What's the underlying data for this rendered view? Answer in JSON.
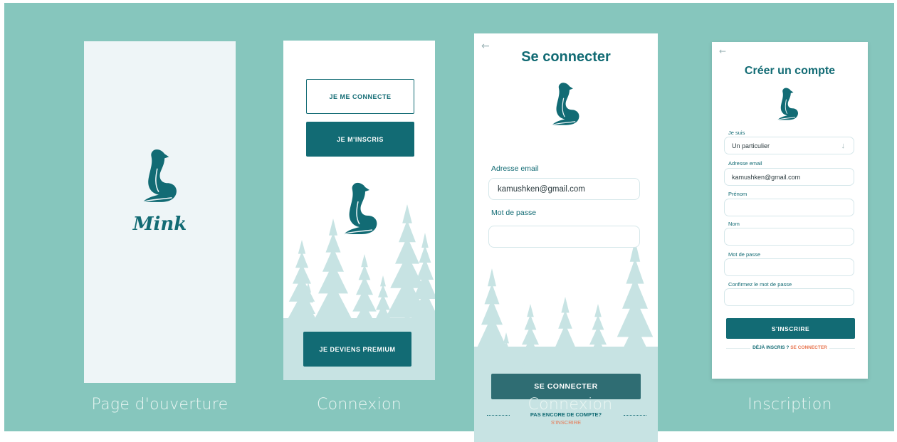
{
  "colors": {
    "canvas": "#86c6bd",
    "brand": "#126b74",
    "accent": "#e8754f",
    "trees": "#c7e3e3"
  },
  "screens": {
    "opening": {
      "brand_name": "Mink",
      "caption": "Page d'ouverture"
    },
    "connexion": {
      "login_button": "JE ME CONNECTE",
      "signup_button": "JE M'INSCRIS",
      "premium_button": "JE DEVIENS PREMIUM",
      "caption": "Connexion"
    },
    "login": {
      "title": "Se connecter",
      "email_label": "Adresse email",
      "email_value": "kamushken@gmail.com",
      "password_label": "Mot de passe",
      "password_value": "",
      "submit_button": "SE CONNECTER",
      "no_account_text": "PAS ENCORE DE COMPTE?",
      "signup_link": "S'INSCRIRE",
      "caption": "Connexion"
    },
    "signup": {
      "title": "Créer un compte",
      "type_label": "Je suis",
      "type_value": "Un particulier",
      "email_label": "Adresse email",
      "email_value": "kamushken@gmail.com",
      "firstname_label": "Prénom",
      "lastname_label": "Nom",
      "password_label": "Mot de passe",
      "confirm_label": "Confirmez le mot de passe",
      "submit_button": "S'INSCRIRE",
      "already_text": "DÉJÀ INSCRIS ?",
      "login_link": "SE CONNECTER",
      "caption": "Inscription"
    }
  }
}
